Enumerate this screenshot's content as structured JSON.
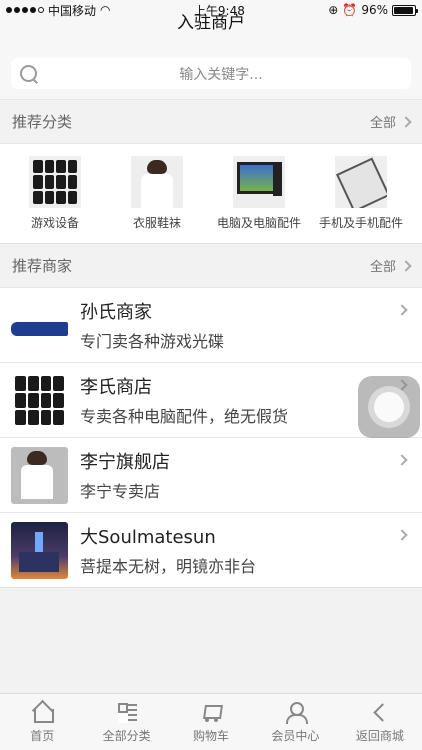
{
  "status_bar": {
    "carrier": "中国移动",
    "time": "上午9:48",
    "battery": "96%"
  },
  "header": {
    "title": "入驻商户"
  },
  "search": {
    "placeholder": "输入关键字..."
  },
  "recommended_categories": {
    "title": "推荐分类",
    "more_label": "全部",
    "items": [
      {
        "label": "游戏设备",
        "icon": "game-devices-icon"
      },
      {
        "label": "衣服鞋袜",
        "icon": "clothing-icon"
      },
      {
        "label": "电脑及电脑配件",
        "icon": "computer-icon"
      },
      {
        "label": "手机及手机配件",
        "icon": "phone-icon"
      }
    ]
  },
  "recommended_merchants": {
    "title": "推荐商家",
    "more_label": "全部",
    "items": [
      {
        "name": "孙氏商家",
        "desc": "专门卖各种游戏光碟"
      },
      {
        "name": "李氏商店",
        "desc": "专卖各种电脑配件，绝无假货"
      },
      {
        "name": "李宁旗舰店",
        "desc": "李宁专卖店"
      },
      {
        "name": "大Soulmatesun",
        "desc": "菩提本无树，明镜亦非台"
      }
    ]
  },
  "tab_bar": {
    "items": [
      {
        "label": "首页"
      },
      {
        "label": "全部分类"
      },
      {
        "label": "购物车"
      },
      {
        "label": "会员中心"
      },
      {
        "label": "返回商城"
      }
    ]
  }
}
